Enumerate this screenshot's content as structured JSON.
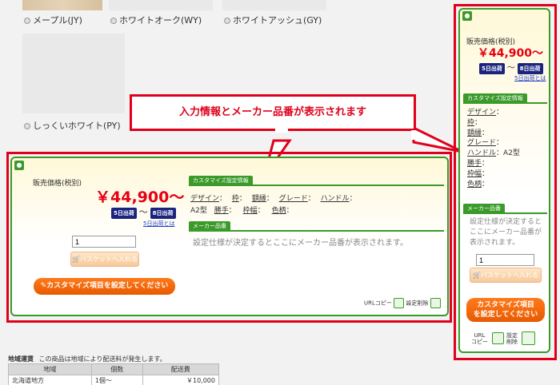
{
  "swatches": [
    {
      "label": "メープル(JY)"
    },
    {
      "label": "ホワイトオーク(WY)"
    },
    {
      "label": "ホワイトアッシュ(GY)"
    },
    {
      "label": "しっくいホワイト(PY)"
    }
  ],
  "callout": {
    "text": "入力情報とメーカー品番が表示されます"
  },
  "main_panel": {
    "price_label": "販売価格(税別)",
    "price": "￥44,900～",
    "ship_from": "5日出荷",
    "ship_tilde": "～",
    "ship_to": "8日出荷",
    "ship_link": "5日出荷とは",
    "quantity": "1",
    "basket_label": "バスケットへ入れる",
    "customize_button": "カスタマイズ項目を設定してください",
    "custom_section": "カスタマイズ設定情報",
    "attrs": [
      "デザイン",
      "枠",
      "額縁",
      "グレード",
      "ハンドル"
    ],
    "attr_colon": "：",
    "handle_value": "A2型",
    "attrs2": [
      "勝手",
      "枠幅",
      "色柄"
    ],
    "maker_section": "メーカー品番",
    "maker_text": "設定仕様が決定するとここにメーカー品番が表示されます。",
    "url_copy": "URLコピー",
    "reset": "設定削除"
  },
  "side_panel": {
    "price_label": "販売価格(税別)",
    "price": "￥44,900～",
    "ship_from": "5日出荷",
    "ship_tilde": "～",
    "ship_to": "8日出荷",
    "ship_link": "5日出荷とは",
    "custom_section": "カスタマイズ設定情報",
    "attrs": [
      "デザイン",
      "枠",
      "額縁",
      "グレード",
      "ハンドル",
      "勝手",
      "枠幅",
      "色柄"
    ],
    "handle_value": "A2型",
    "maker_section": "メーカー品番",
    "maker_text": "設定仕様が決定するとここにメーカー品番が表示されます。",
    "quantity": "1",
    "basket_label": "バスケットへ入れる",
    "customize_line1": "カスタマイズ項目",
    "customize_line2": "を設定してください",
    "url_copy_1": "URL",
    "url_copy_2": "コピー",
    "reset_1": "設定",
    "reset_2": "削除"
  },
  "shipping": {
    "title": "地域運賃",
    "note": "この商品は地域により配送料が発生します。",
    "headers": [
      "地域",
      "個数",
      "配送費"
    ],
    "rows": [
      [
        "北海道地方",
        "1個～",
        "￥10,000"
      ]
    ]
  },
  "colors": {
    "accent_green": "#3a9a2a",
    "price_red": "#e60012",
    "frame_red": "#e0001c",
    "button_orange": "#ff7a1a",
    "ship_navy": "#1a237e"
  }
}
